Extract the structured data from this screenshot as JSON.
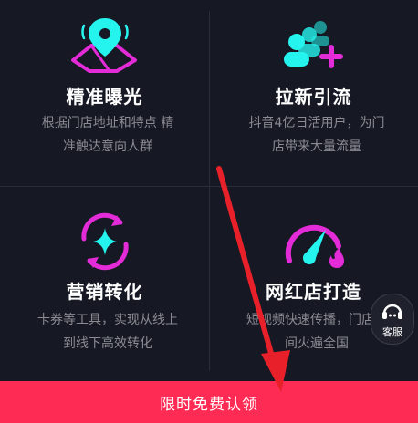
{
  "features": [
    {
      "icon": "map-pin-icon",
      "title": "精准曝光",
      "desc_lines": [
        "根据门店地址和特点 精",
        "准触达意向人群"
      ]
    },
    {
      "icon": "users-add-icon",
      "title": "拉新引流",
      "desc_lines": [
        "抖音4亿日活用户，为门",
        "店带来大量流量"
      ]
    },
    {
      "icon": "refresh-sparkle-icon",
      "title": "营销转化",
      "desc_lines": [
        "卡券等工具，实现从线上",
        "到线下高效转化"
      ]
    },
    {
      "icon": "speedometer-fire-icon",
      "title": "网红店打造",
      "desc_lines": [
        "短视频快速传播，门店时",
        "间火遍全国"
      ]
    }
  ],
  "customer_service": {
    "label": "客服",
    "icon": "headset-icon"
  },
  "cta": {
    "label": "限时免费认领"
  },
  "colors": {
    "background": "#161823",
    "accent": "#fe2c55",
    "cyan": "#25f4ee",
    "magenta": "#e42bd8",
    "annotation_arrow": "#e8202a"
  }
}
